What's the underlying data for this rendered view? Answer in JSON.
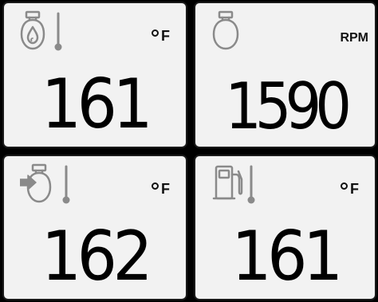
{
  "gauges": [
    {
      "icon": "oil-temperature-icon",
      "unit": "F",
      "value": "161"
    },
    {
      "icon": "engine-rpm-icon",
      "unit": "RPM",
      "value": "1590"
    },
    {
      "icon": "coolant-temperature-icon",
      "unit": "F",
      "value": "162"
    },
    {
      "icon": "fuel-temperature-icon",
      "unit": "F",
      "value": "161"
    }
  ],
  "colors": {
    "background": "#000000",
    "panel": "#f2f2f2",
    "icon": "#8a8a8a",
    "text": "#000000"
  }
}
